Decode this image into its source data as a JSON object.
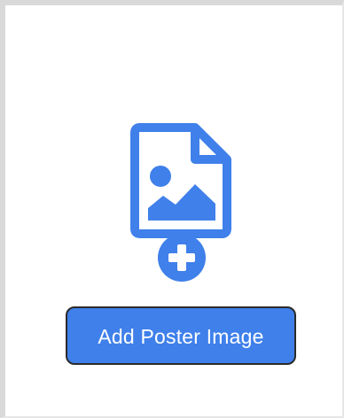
{
  "poster": {
    "icon": "add-image-file-icon",
    "plus_icon": "plus-circle-icon",
    "accent_color": "#3f80ea"
  },
  "actions": {
    "add_poster_label": "Add Poster Image"
  }
}
